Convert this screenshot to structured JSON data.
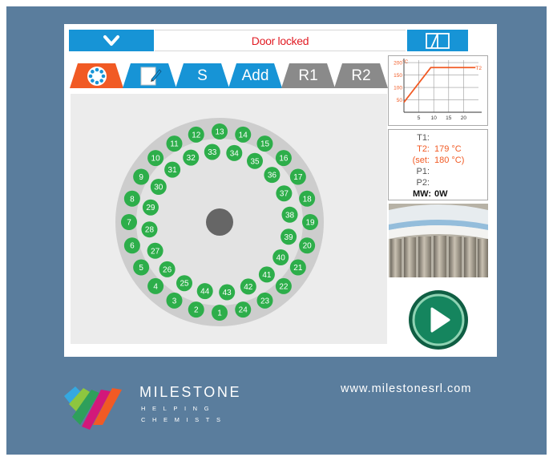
{
  "header": {
    "status_text": "Door locked",
    "menu_icon": "chevron-down-icon",
    "manual_icon": "book-icon",
    "colors": {
      "bar": "#1794d6",
      "status": "#e11d25"
    }
  },
  "tabs": [
    {
      "label": "",
      "icon": "rotor-icon",
      "active": true
    },
    {
      "label": "",
      "icon": "edit-note-icon"
    },
    {
      "label": "S"
    },
    {
      "label": "Add"
    },
    {
      "label": "R1"
    },
    {
      "label": "R2"
    }
  ],
  "rotor": {
    "positions": [
      "1",
      "2",
      "3",
      "4",
      "5",
      "6",
      "7",
      "8",
      "9",
      "10",
      "11",
      "12",
      "13",
      "14",
      "15",
      "16",
      "17",
      "18",
      "19",
      "20",
      "21",
      "22",
      "23",
      "24",
      "25",
      "26",
      "27",
      "28",
      "29",
      "30",
      "31",
      "32",
      "33",
      "34",
      "35",
      "36",
      "37",
      "38",
      "39",
      "40",
      "41",
      "42",
      "43",
      "44"
    ],
    "vessel_color": "#2dae4a"
  },
  "chart_data": {
    "type": "line",
    "ylabel": "°C",
    "series": [
      {
        "name": "T2",
        "x": [
          0,
          9,
          24
        ],
        "y": [
          40,
          180,
          180
        ]
      }
    ],
    "x_ticks": [
      "5",
      "10",
      "15",
      "20"
    ],
    "y_ticks": [
      "50",
      "100",
      "150",
      "200"
    ],
    "xlim": [
      0,
      25
    ],
    "ylim": [
      0,
      210
    ],
    "grid": true,
    "line_color": "#f15a24"
  },
  "readout": {
    "t1_label": "T1:",
    "t1_value": "",
    "t2_label": "T2:",
    "t2_value": "179 °C",
    "set_label": "(set:",
    "set_value": "180 °C)",
    "p1_label": "P1:",
    "p1_value": "",
    "p2_label": "P2:",
    "p2_value": "",
    "mw_label": "MW:",
    "mw_value": "0W"
  },
  "play_button_icon": "play-icon",
  "footer": {
    "brand": "MILESTONE",
    "tagline_1": "HELPING",
    "tagline_2": "CHEMISTS",
    "website": "www.milestonesrl.com"
  }
}
